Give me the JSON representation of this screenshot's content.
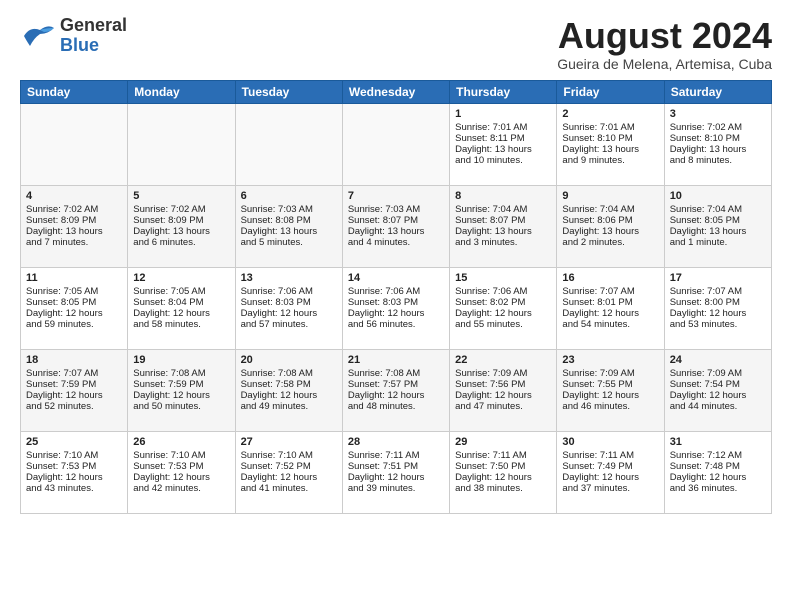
{
  "header": {
    "logo_general": "General",
    "logo_blue": "Blue",
    "month": "August 2024",
    "location": "Gueira de Melena, Artemisa, Cuba"
  },
  "days_of_week": [
    "Sunday",
    "Monday",
    "Tuesday",
    "Wednesday",
    "Thursday",
    "Friday",
    "Saturday"
  ],
  "weeks": [
    [
      {
        "day": "",
        "info": ""
      },
      {
        "day": "",
        "info": ""
      },
      {
        "day": "",
        "info": ""
      },
      {
        "day": "",
        "info": ""
      },
      {
        "day": "1",
        "info": "Sunrise: 7:01 AM\nSunset: 8:11 PM\nDaylight: 13 hours\nand 10 minutes."
      },
      {
        "day": "2",
        "info": "Sunrise: 7:01 AM\nSunset: 8:10 PM\nDaylight: 13 hours\nand 9 minutes."
      },
      {
        "day": "3",
        "info": "Sunrise: 7:02 AM\nSunset: 8:10 PM\nDaylight: 13 hours\nand 8 minutes."
      }
    ],
    [
      {
        "day": "4",
        "info": "Sunrise: 7:02 AM\nSunset: 8:09 PM\nDaylight: 13 hours\nand 7 minutes."
      },
      {
        "day": "5",
        "info": "Sunrise: 7:02 AM\nSunset: 8:09 PM\nDaylight: 13 hours\nand 6 minutes."
      },
      {
        "day": "6",
        "info": "Sunrise: 7:03 AM\nSunset: 8:08 PM\nDaylight: 13 hours\nand 5 minutes."
      },
      {
        "day": "7",
        "info": "Sunrise: 7:03 AM\nSunset: 8:07 PM\nDaylight: 13 hours\nand 4 minutes."
      },
      {
        "day": "8",
        "info": "Sunrise: 7:04 AM\nSunset: 8:07 PM\nDaylight: 13 hours\nand 3 minutes."
      },
      {
        "day": "9",
        "info": "Sunrise: 7:04 AM\nSunset: 8:06 PM\nDaylight: 13 hours\nand 2 minutes."
      },
      {
        "day": "10",
        "info": "Sunrise: 7:04 AM\nSunset: 8:05 PM\nDaylight: 13 hours\nand 1 minute."
      }
    ],
    [
      {
        "day": "11",
        "info": "Sunrise: 7:05 AM\nSunset: 8:05 PM\nDaylight: 12 hours\nand 59 minutes."
      },
      {
        "day": "12",
        "info": "Sunrise: 7:05 AM\nSunset: 8:04 PM\nDaylight: 12 hours\nand 58 minutes."
      },
      {
        "day": "13",
        "info": "Sunrise: 7:06 AM\nSunset: 8:03 PM\nDaylight: 12 hours\nand 57 minutes."
      },
      {
        "day": "14",
        "info": "Sunrise: 7:06 AM\nSunset: 8:03 PM\nDaylight: 12 hours\nand 56 minutes."
      },
      {
        "day": "15",
        "info": "Sunrise: 7:06 AM\nSunset: 8:02 PM\nDaylight: 12 hours\nand 55 minutes."
      },
      {
        "day": "16",
        "info": "Sunrise: 7:07 AM\nSunset: 8:01 PM\nDaylight: 12 hours\nand 54 minutes."
      },
      {
        "day": "17",
        "info": "Sunrise: 7:07 AM\nSunset: 8:00 PM\nDaylight: 12 hours\nand 53 minutes."
      }
    ],
    [
      {
        "day": "18",
        "info": "Sunrise: 7:07 AM\nSunset: 7:59 PM\nDaylight: 12 hours\nand 52 minutes."
      },
      {
        "day": "19",
        "info": "Sunrise: 7:08 AM\nSunset: 7:59 PM\nDaylight: 12 hours\nand 50 minutes."
      },
      {
        "day": "20",
        "info": "Sunrise: 7:08 AM\nSunset: 7:58 PM\nDaylight: 12 hours\nand 49 minutes."
      },
      {
        "day": "21",
        "info": "Sunrise: 7:08 AM\nSunset: 7:57 PM\nDaylight: 12 hours\nand 48 minutes."
      },
      {
        "day": "22",
        "info": "Sunrise: 7:09 AM\nSunset: 7:56 PM\nDaylight: 12 hours\nand 47 minutes."
      },
      {
        "day": "23",
        "info": "Sunrise: 7:09 AM\nSunset: 7:55 PM\nDaylight: 12 hours\nand 46 minutes."
      },
      {
        "day": "24",
        "info": "Sunrise: 7:09 AM\nSunset: 7:54 PM\nDaylight: 12 hours\nand 44 minutes."
      }
    ],
    [
      {
        "day": "25",
        "info": "Sunrise: 7:10 AM\nSunset: 7:53 PM\nDaylight: 12 hours\nand 43 minutes."
      },
      {
        "day": "26",
        "info": "Sunrise: 7:10 AM\nSunset: 7:53 PM\nDaylight: 12 hours\nand 42 minutes."
      },
      {
        "day": "27",
        "info": "Sunrise: 7:10 AM\nSunset: 7:52 PM\nDaylight: 12 hours\nand 41 minutes."
      },
      {
        "day": "28",
        "info": "Sunrise: 7:11 AM\nSunset: 7:51 PM\nDaylight: 12 hours\nand 39 minutes."
      },
      {
        "day": "29",
        "info": "Sunrise: 7:11 AM\nSunset: 7:50 PM\nDaylight: 12 hours\nand 38 minutes."
      },
      {
        "day": "30",
        "info": "Sunrise: 7:11 AM\nSunset: 7:49 PM\nDaylight: 12 hours\nand 37 minutes."
      },
      {
        "day": "31",
        "info": "Sunrise: 7:12 AM\nSunset: 7:48 PM\nDaylight: 12 hours\nand 36 minutes."
      }
    ]
  ]
}
